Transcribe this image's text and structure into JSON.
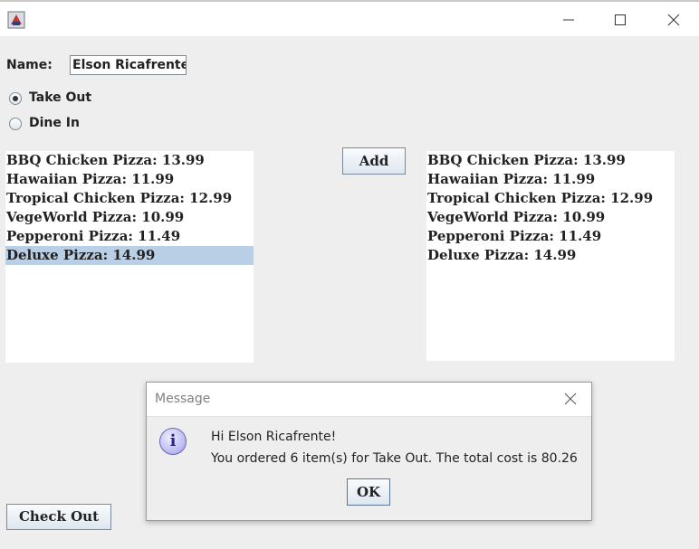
{
  "window": {
    "icons": {
      "app": "java-app-icon",
      "minimize": "minimize-icon",
      "maximize": "maximize-icon",
      "close": "close-icon"
    }
  },
  "form": {
    "name_label": "Name:",
    "name_value": "Elson Ricafrente",
    "order_type": [
      {
        "label": "Take Out",
        "selected": true
      },
      {
        "label": "Dine In",
        "selected": false
      }
    ],
    "add_label": "Add",
    "checkout_label": "Check Out"
  },
  "menu_list": {
    "items": [
      "BBQ Chicken Pizza: 13.99",
      "Hawaiian Pizza: 11.99",
      "Tropical Chicken Pizza: 12.99",
      "VegeWorld Pizza: 10.99",
      "Pepperoni Pizza: 11.49",
      "Deluxe Pizza: 14.99"
    ],
    "selected_index": 5,
    "selection_color": "#b8cfe5"
  },
  "order_list": {
    "items": [
      "BBQ Chicken Pizza: 13.99",
      "Hawaiian Pizza: 11.99",
      "Tropical Chicken Pizza: 12.99",
      "VegeWorld Pizza: 10.99",
      "Pepperoni Pizza: 11.49",
      "Deluxe Pizza: 14.99"
    ]
  },
  "dialog": {
    "title": "Message",
    "icon": "info-icon",
    "line1": "Hi Elson Ricafrente!",
    "line2": "You ordered 6 item(s) for Take Out. The total cost is 80.26",
    "ok_label": "OK"
  }
}
